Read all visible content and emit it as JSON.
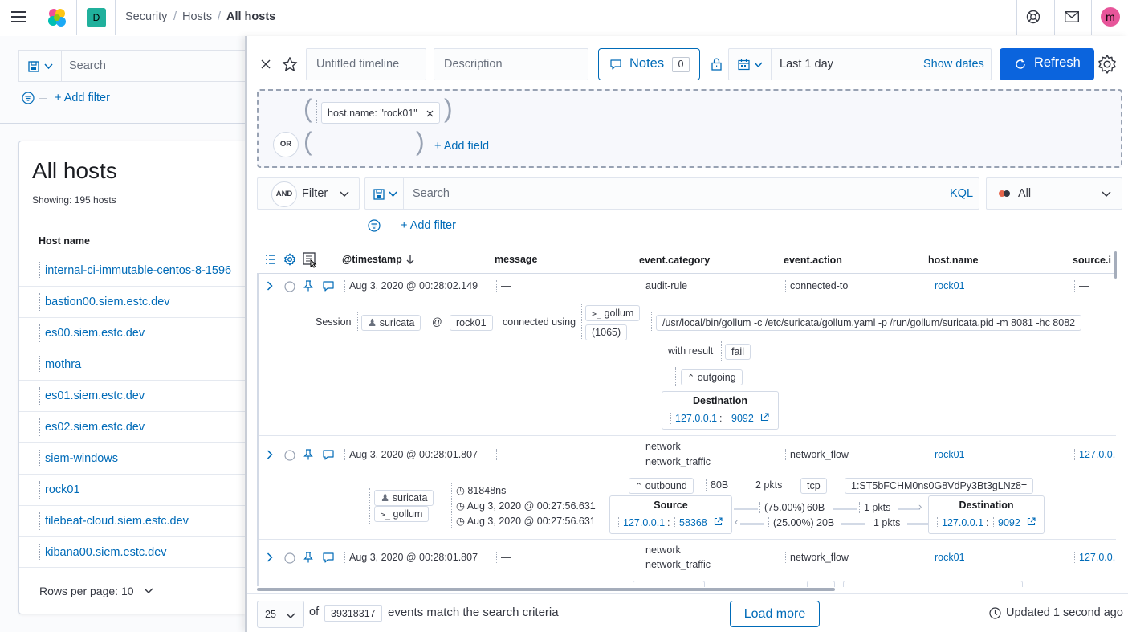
{
  "header": {
    "space_initial": "D",
    "breadcrumbs": [
      "Security",
      "Hosts",
      "All hosts"
    ],
    "user_initial": "m"
  },
  "left": {
    "search_placeholder": "Search",
    "add_filter": "+ Add filter",
    "title": "All hosts",
    "showing": "Showing: 195 hosts",
    "column_host_name": "Host name",
    "hosts": [
      "internal-ci-immutable-centos-8-1596",
      "bastion00.siem.estc.dev",
      "es00.siem.estc.dev",
      "mothra",
      "es01.siem.estc.dev",
      "es02.siem.estc.dev",
      "siem-windows",
      "rock01",
      "filebeat-cloud.siem.estc.dev",
      "kibana00.siem.estc.dev"
    ],
    "rows_per_page": "Rows per page: 10"
  },
  "timeline": {
    "title_placeholder": "Untitled timeline",
    "description_placeholder": "Description",
    "notes_label": "Notes",
    "notes_count": "0",
    "date_range": "Last 1 day",
    "show_dates": "Show dates",
    "refresh": "Refresh",
    "dataprovider_chip": "host.name: \"rock01\"",
    "or_badge": "OR",
    "add_field": "+ Add field",
    "and_badge": "AND",
    "filter_label": "Filter",
    "search_placeholder": "Search",
    "kql": "KQL",
    "event_type": "All",
    "add_filter": "+ Add filter",
    "columns": [
      "@timestamp",
      "message",
      "event.category",
      "event.action",
      "host.name",
      "source.i"
    ],
    "events": [
      {
        "timestamp": "Aug 3, 2020 @ 00:28:02.149",
        "message": "—",
        "category": [
          "audit-rule"
        ],
        "action": "connected-to",
        "host": "rock01",
        "source": "—",
        "row": {
          "session_label": "Session",
          "user": "suricata",
          "at": "@",
          "host": "rock01",
          "connected_using": "connected using",
          "process": "gollum",
          "pid": "(1065)",
          "command": "/usr/local/bin/gollum -c /etc/suricata/gollum.yaml -p /run/gollum/suricata.pid -m 8081 -hc 8082",
          "with_result": "with result",
          "result": "fail",
          "direction": "outgoing",
          "destination_title": "Destination",
          "destination_ip": "127.0.0.1",
          "colon": ":",
          "destination_port": "9092"
        }
      },
      {
        "timestamp": "Aug 3, 2020 @ 00:28:01.807",
        "message": "—",
        "category": [
          "network",
          "network_traffic"
        ],
        "action": "network_flow",
        "host": "rock01",
        "source": "127.0.0.",
        "row": {
          "user": "suricata",
          "process": "gollum",
          "duration": "81848ns",
          "start": "Aug 3, 2020 @ 00:27:56.631",
          "end": "Aug 3, 2020 @ 00:27:56.631",
          "direction": "outbound",
          "bytes": "80B",
          "packets": "2 pkts",
          "transport": "tcp",
          "community_id": "1:ST5bFCHM0ns0G8VdPy3Bt3gLNz8=",
          "source_title": "Source",
          "source_ip": "127.0.0.1",
          "colon": ":",
          "source_port": "58368",
          "out_pct": "(75.00%)",
          "out_bytes": "60B",
          "out_pkts": "1 pkts",
          "in_pct": "(25.00%)",
          "in_bytes": "20B",
          "in_pkts": "1 pkts",
          "destination_title": "Destination",
          "destination_ip": "127.0.0.1",
          "destination_port": "9092"
        }
      },
      {
        "timestamp": "Aug 3, 2020 @ 00:28:01.807",
        "message": "—",
        "category": [
          "network",
          "network_traffic"
        ],
        "action": "network_flow",
        "host": "rock01",
        "source": "127.0.0."
      }
    ],
    "footer": {
      "page_size": "25",
      "of": "of",
      "total": "39318317",
      "match_text": "events match the search criteria",
      "load_more": "Load more",
      "updated": "Updated 1 second ago"
    }
  },
  "colors": {
    "primary": "#006bb8",
    "refresh_bg": "#0b64dd",
    "space_badge": "#20b09c",
    "avatar": "#e7559a"
  }
}
